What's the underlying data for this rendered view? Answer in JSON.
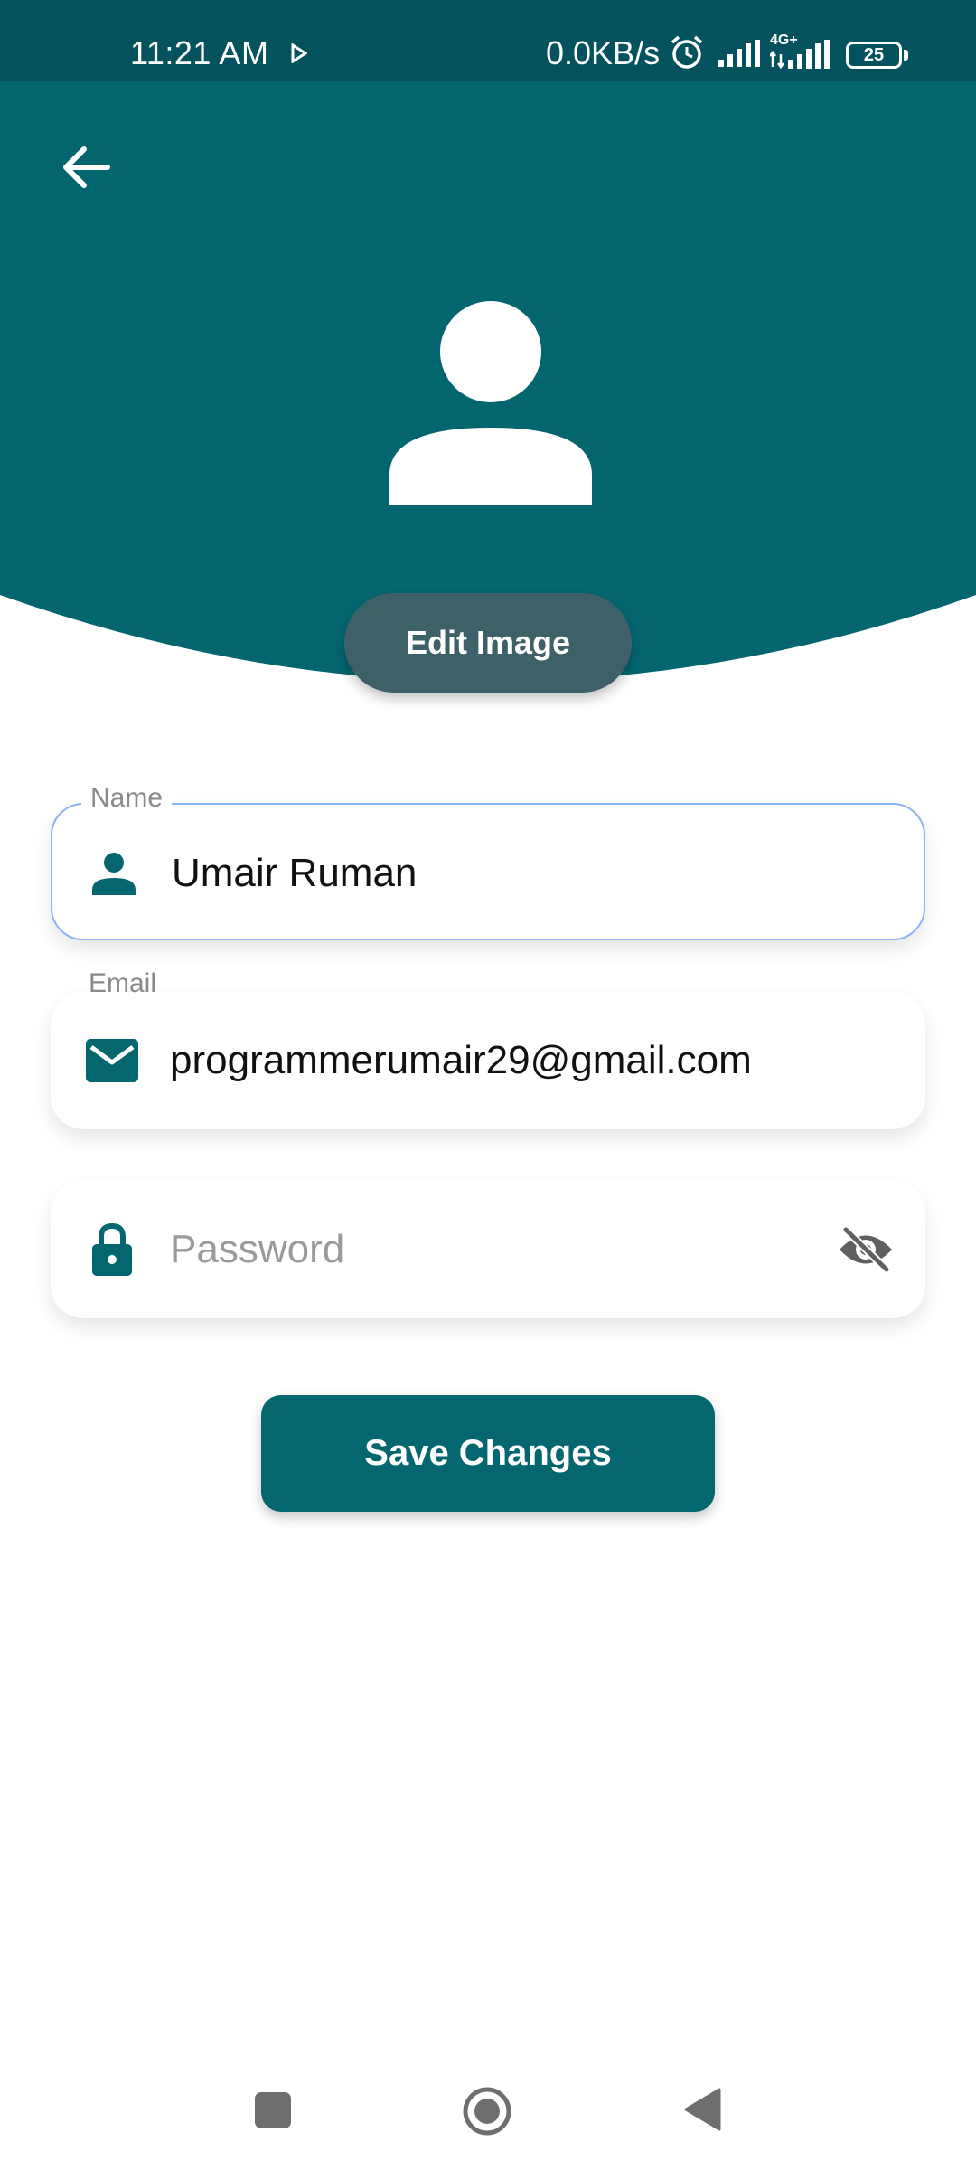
{
  "status_bar": {
    "time": "11:21 AM",
    "network_speed": "0.0KB/s",
    "network_type": "4G+",
    "battery": "25"
  },
  "header": {
    "back_icon": "arrow-left-icon",
    "avatar_icon": "person-avatar-icon",
    "edit_image_label": "Edit Image"
  },
  "form": {
    "name": {
      "label": "Name",
      "value": "Umair Ruman",
      "icon": "person-icon"
    },
    "email": {
      "label": "Email",
      "value": "programmerumair29@gmail.com",
      "icon": "mail-icon"
    },
    "password": {
      "placeholder": "Password",
      "icon": "lock-icon",
      "toggle_icon": "eye-off-icon"
    },
    "save_label": "Save Changes"
  },
  "colors": {
    "header": "#03666f",
    "status_bar": "#04525d",
    "accent": "#04666f",
    "edit_button": "#3e6169",
    "focus_border": "#8bb4f3"
  }
}
